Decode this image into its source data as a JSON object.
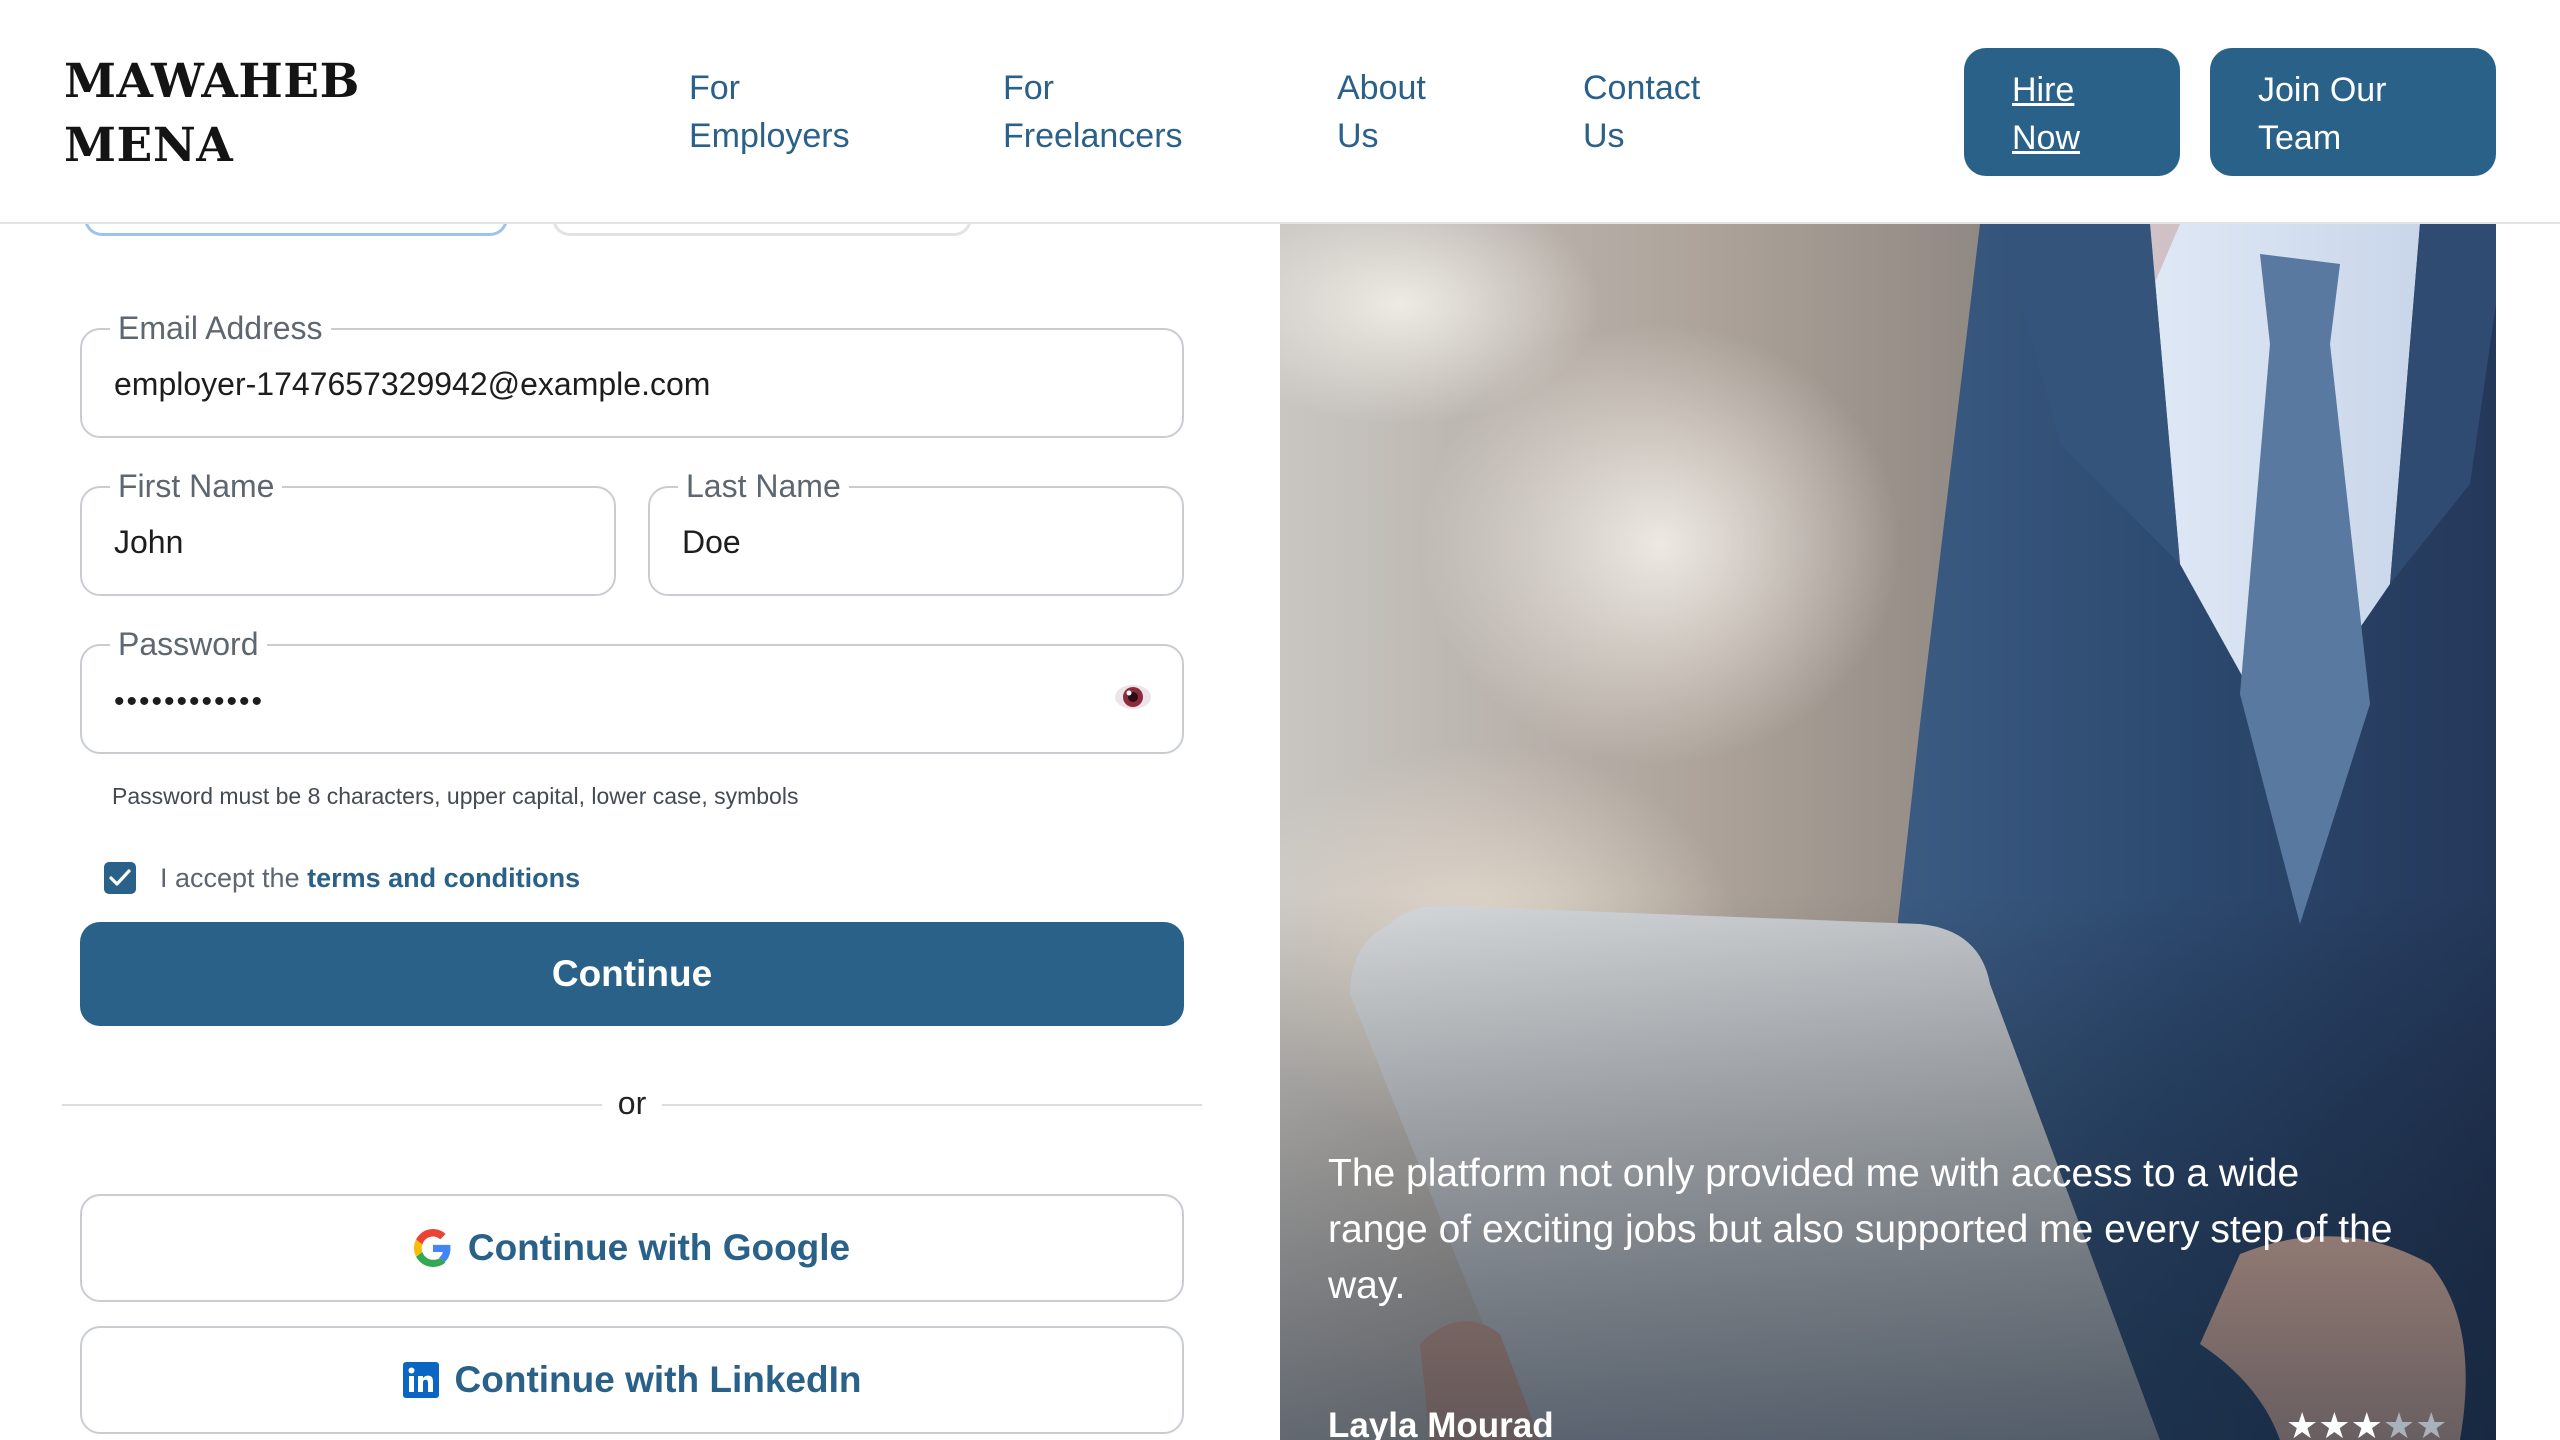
{
  "brand": {
    "line1": "MAWAHEB",
    "line2": "MENA"
  },
  "nav": [
    {
      "line1": "For",
      "line2": "Employers"
    },
    {
      "line1": "For",
      "line2": "Freelancers"
    },
    {
      "line1": "About",
      "line2": "Us"
    },
    {
      "line1": "Contact",
      "line2": "Us"
    }
  ],
  "header_buttons": {
    "hire": {
      "line1": "Hire",
      "line2": "Now"
    },
    "join": {
      "line1": "Join Our",
      "line2": "Team"
    }
  },
  "form": {
    "email": {
      "label": "Email Address",
      "value": "employer-1747657329942@example.com"
    },
    "first_name": {
      "label": "First Name",
      "value": "John"
    },
    "last_name": {
      "label": "Last Name",
      "value": "Doe"
    },
    "password": {
      "label": "Password",
      "value": "••••••••••••",
      "toggle_icon": "eye-icon"
    },
    "password_hint": "Password must be 8 characters, upper capital, lower case, symbols",
    "terms": {
      "checked": true,
      "prefix": "I accept the ",
      "link": "terms and conditions"
    },
    "continue_label": "Continue",
    "divider": "or",
    "google_label": "Continue with Google",
    "linkedin_label": "Continue with LinkedIn"
  },
  "testimonial": {
    "quote": "The platform not only provided me with access to a wide range of exciting jobs but also supported me every step of the way.",
    "author": "Layla Mourad",
    "rating": 3,
    "rating_max": 5
  },
  "colors": {
    "primary": "#2a6189",
    "nav_text": "#2a6089",
    "border": "#c9cdd2"
  }
}
